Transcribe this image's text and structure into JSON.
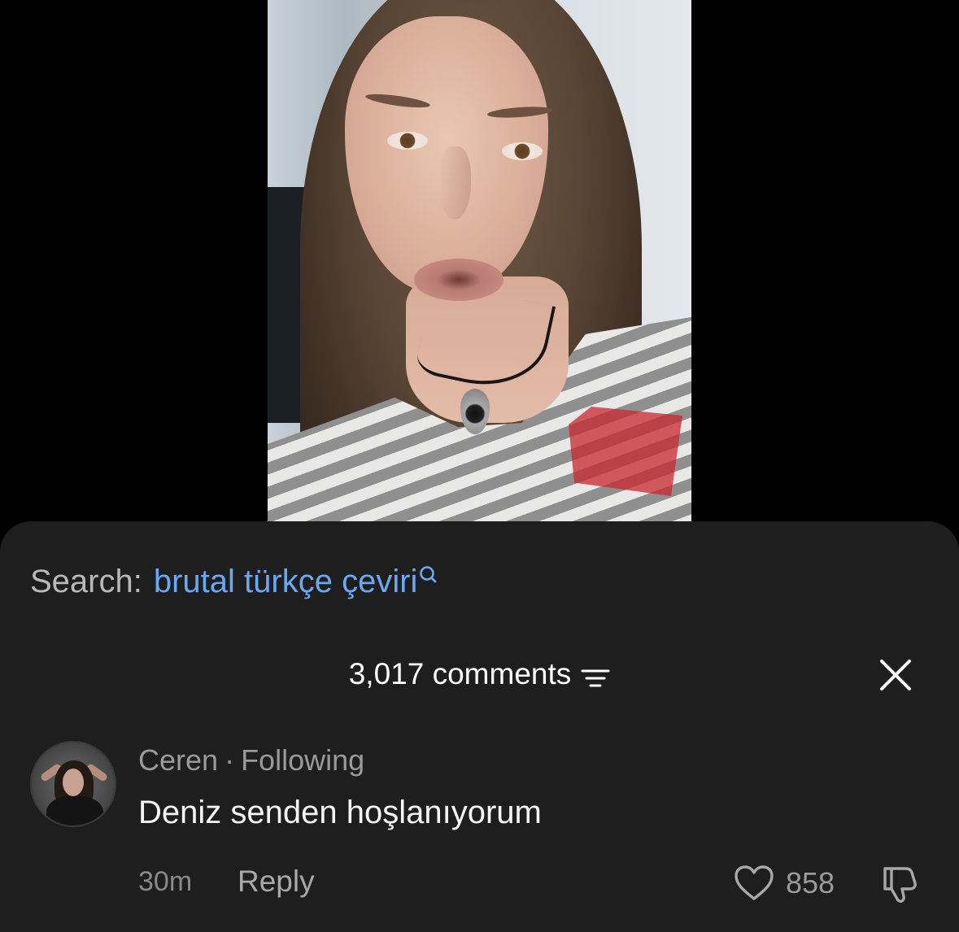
{
  "search": {
    "label": "Search:",
    "query": "brutal türkçe çeviri",
    "icon": "search-icon",
    "query_color": "#6aa8f2"
  },
  "comments_panel": {
    "count_label": "3,017 comments",
    "sort_icon": "sort-filter-icon",
    "close_icon": "close-icon"
  },
  "comment": {
    "author": "Ceren",
    "separator": "·",
    "relation": "Following",
    "text": "Deniz senden hoşlanıyorum",
    "time": "30m",
    "reply_label": "Reply",
    "likes": "858",
    "like_icon": "heart-outline-icon",
    "dislike_icon": "thumbs-down-icon"
  },
  "colors": {
    "sheet_background": "#1e1e1e",
    "page_background": "#000000"
  }
}
